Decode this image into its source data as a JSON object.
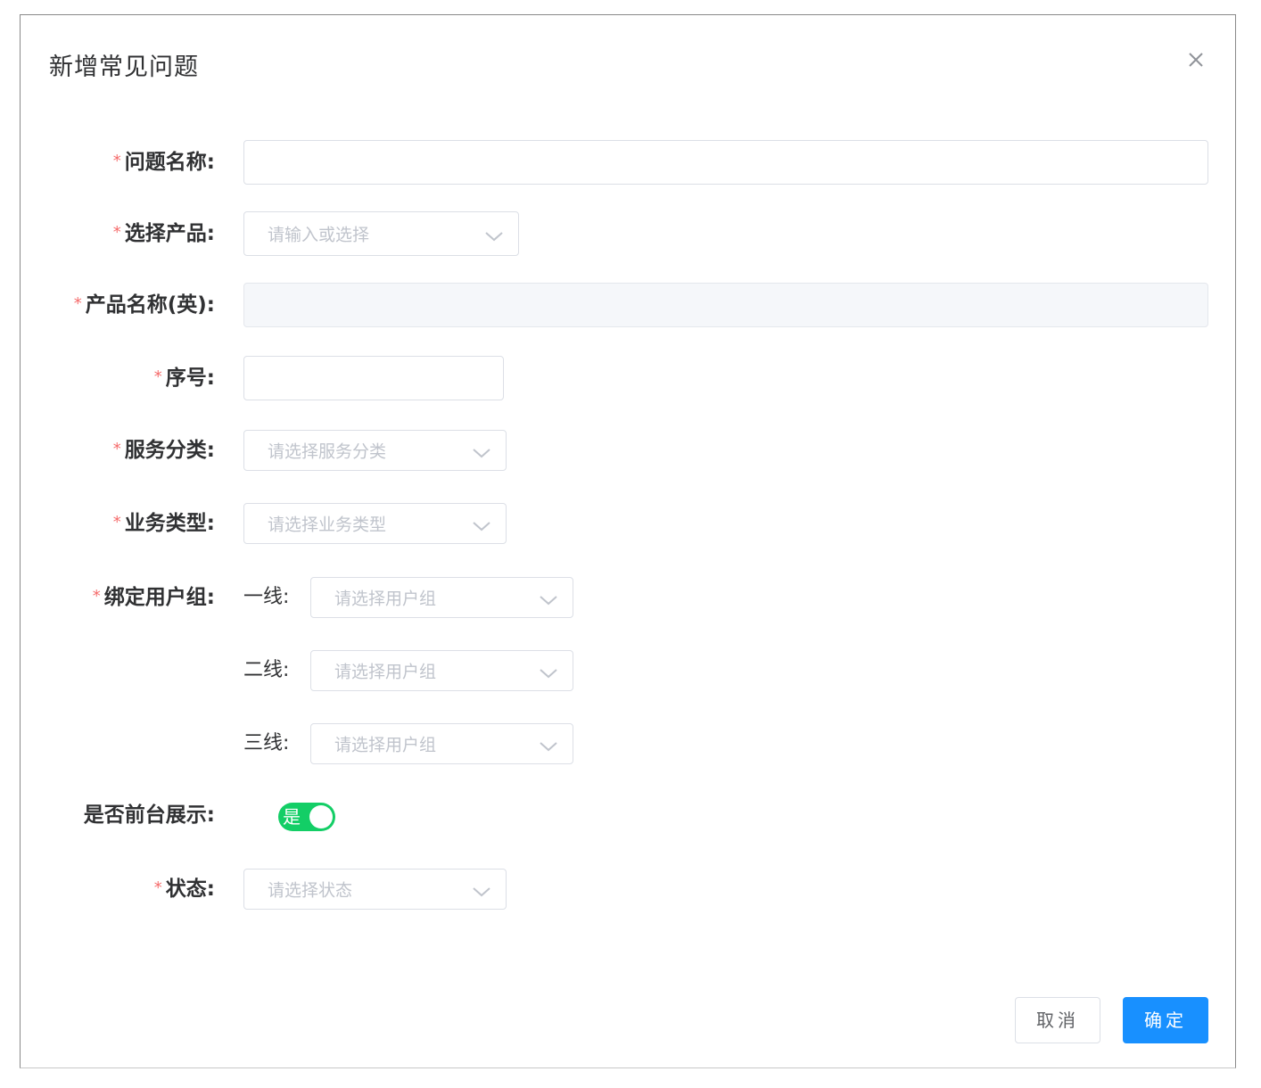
{
  "dialog": {
    "title": "新增常见问题",
    "close_icon": "close-icon"
  },
  "form": {
    "required_mark": "*",
    "question_name": {
      "label": "问题名称:",
      "value": ""
    },
    "product": {
      "label": "选择产品:",
      "placeholder": "请输入或选择"
    },
    "product_name_en": {
      "label": "产品名称(英):",
      "value": ""
    },
    "sequence": {
      "label": "序号:",
      "value": ""
    },
    "service_category": {
      "label": "服务分类:",
      "placeholder": "请选择服务分类"
    },
    "business_type": {
      "label": "业务类型:",
      "placeholder": "请选择业务类型"
    },
    "user_group": {
      "label": "绑定用户组:",
      "lines": [
        {
          "label": "一线:",
          "placeholder": "请选择用户组"
        },
        {
          "label": "二线:",
          "placeholder": "请选择用户组"
        },
        {
          "label": "三线:",
          "placeholder": "请选择用户组"
        }
      ]
    },
    "frontend_display": {
      "label": "是否前台展示:",
      "switch_text": "是",
      "checked": true
    },
    "status": {
      "label": "状态:",
      "placeholder": "请选择状态"
    }
  },
  "footer": {
    "cancel_label": "取消",
    "confirm_label": "确定"
  },
  "colors": {
    "primary": "#1890ff",
    "switch_on": "#13ce66",
    "required": "#f56c6c"
  }
}
